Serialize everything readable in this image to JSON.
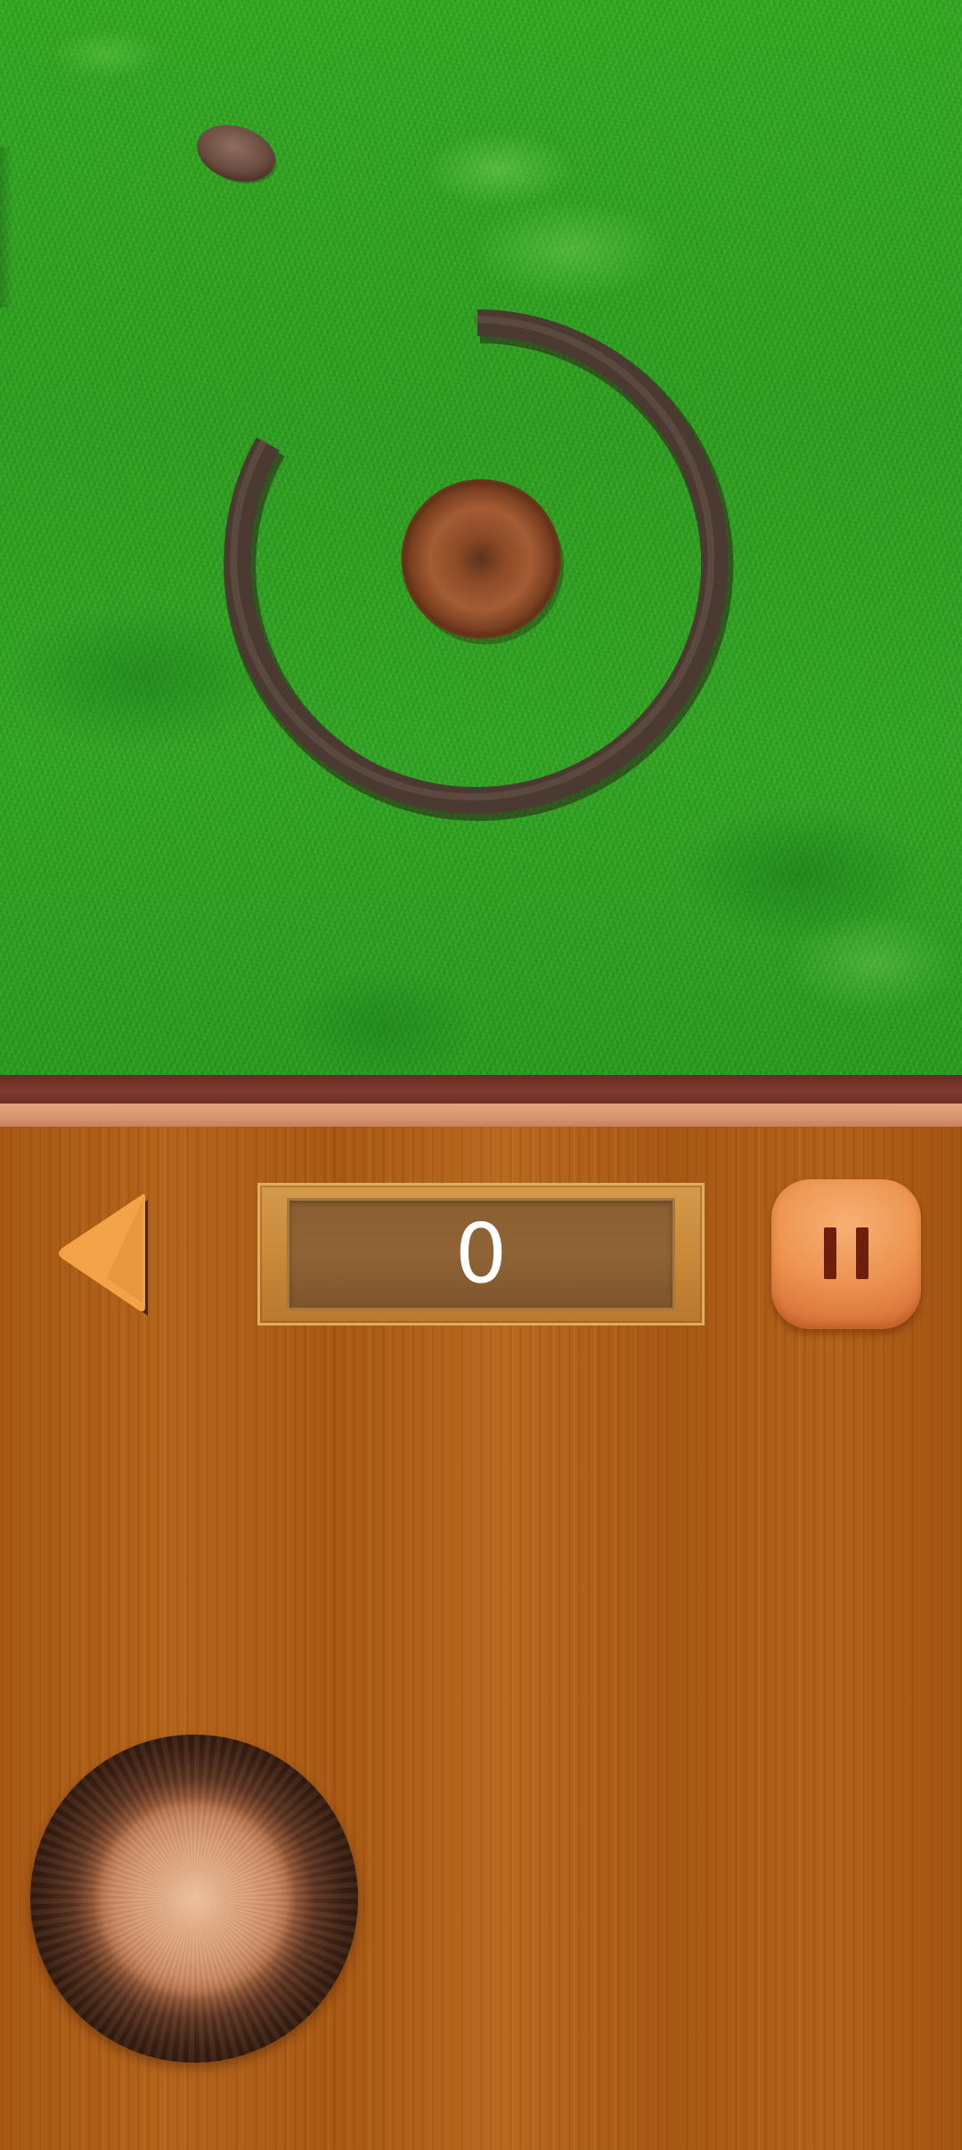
{
  "score": {
    "value": "0"
  },
  "controls": {
    "back_icon": "triangle-left-icon",
    "pause_icon": "pause-icon",
    "joystick": "joystick-knob"
  },
  "colors": {
    "grass": "#33a425",
    "wood": "#ab5b16",
    "accent_orange": "#ee9450",
    "ring": "#4a3a32",
    "ball": "#8b4a26"
  }
}
